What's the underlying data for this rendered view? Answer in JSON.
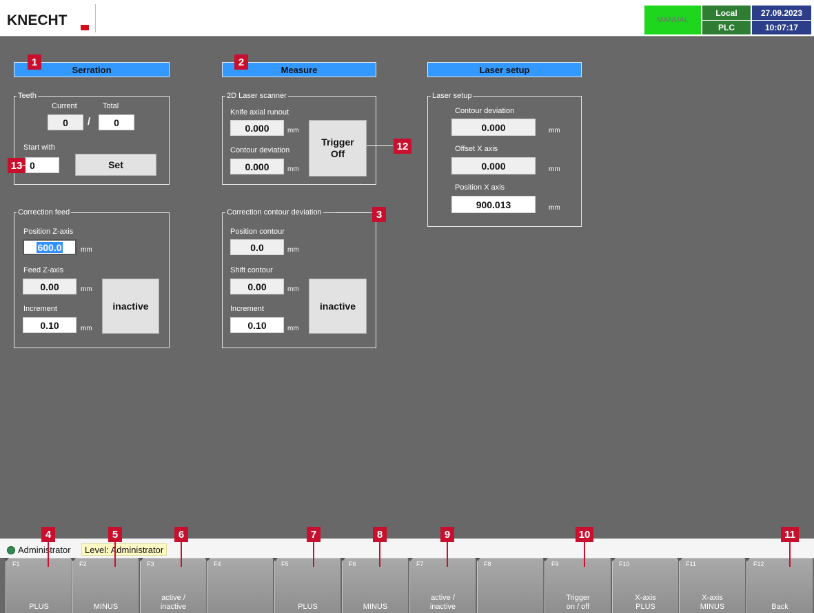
{
  "header": {
    "logo": "KNECHT",
    "mode": "MANUAL",
    "status_top": "Local",
    "status_bottom": "PLC",
    "date": "27.09.2023",
    "time": "10:07:17",
    "mode_color": "#1fd61f"
  },
  "serration": {
    "title": "Serration",
    "teeth": {
      "group_label": "Teeth",
      "current_label": "Current",
      "total_label": "Total",
      "current_value": "0",
      "separator": "/",
      "total_value": "0",
      "start_with_label": "Start with",
      "start_with_value": "0",
      "set_label": "Set"
    },
    "correction_feed": {
      "group_label": "Correction feed",
      "position_label": "Position Z-axis",
      "position_value": "600.0",
      "feed_label": "Feed Z-axis",
      "feed_value": "0.00",
      "increment_label": "Increment",
      "increment_value": "0.10",
      "unit": "mm",
      "toggle_label": "inactive"
    }
  },
  "measure": {
    "title": "Measure",
    "scanner": {
      "group_label": "2D Laser scanner",
      "runout_label": "Knife axial runout",
      "runout_value": "0.000",
      "contour_label": "Contour deviation",
      "contour_value": "0.000",
      "unit": "mm",
      "trigger_line1": "Trigger",
      "trigger_line2": "Off"
    },
    "correction_contour": {
      "group_label": "Correction contour deviation",
      "position_label": "Position contour",
      "position_value": "0.0",
      "shift_label": "Shift contour",
      "shift_value": "0.00",
      "increment_label": "Increment",
      "increment_value": "0.10",
      "unit": "mm",
      "toggle_label": "inactive"
    }
  },
  "laser": {
    "title": "Laser setup",
    "group_label": "Laser setup",
    "contour_label": "Contour deviation",
    "contour_value": "0.000",
    "offset_label": "Offset X axis",
    "offset_value": "0.000",
    "position_label": "Position X axis",
    "position_value": "900.013",
    "unit": "mm"
  },
  "callouts": [
    "1",
    "2",
    "3",
    "4",
    "5",
    "6",
    "7",
    "8",
    "9",
    "10",
    "11",
    "12",
    "13"
  ],
  "status": {
    "user": "Administrator",
    "level": "Level: Administrator"
  },
  "fkeys": [
    {
      "fn": "F1",
      "label": "PLUS"
    },
    {
      "fn": "F2",
      "label": "MINUS"
    },
    {
      "fn": "F3",
      "label": "active /\ninactive"
    },
    {
      "fn": "F4",
      "label": ""
    },
    {
      "fn": "F5",
      "label": "PLUS"
    },
    {
      "fn": "F6",
      "label": "MINUS"
    },
    {
      "fn": "F7",
      "label": "active /\ninactive"
    },
    {
      "fn": "F8",
      "label": ""
    },
    {
      "fn": "F9",
      "label": "Trigger\non / off"
    },
    {
      "fn": "F10",
      "label": "X-axis\nPLUS"
    },
    {
      "fn": "F11",
      "label": "X-axis\nMINUS"
    },
    {
      "fn": "F12",
      "label": "Back"
    }
  ]
}
